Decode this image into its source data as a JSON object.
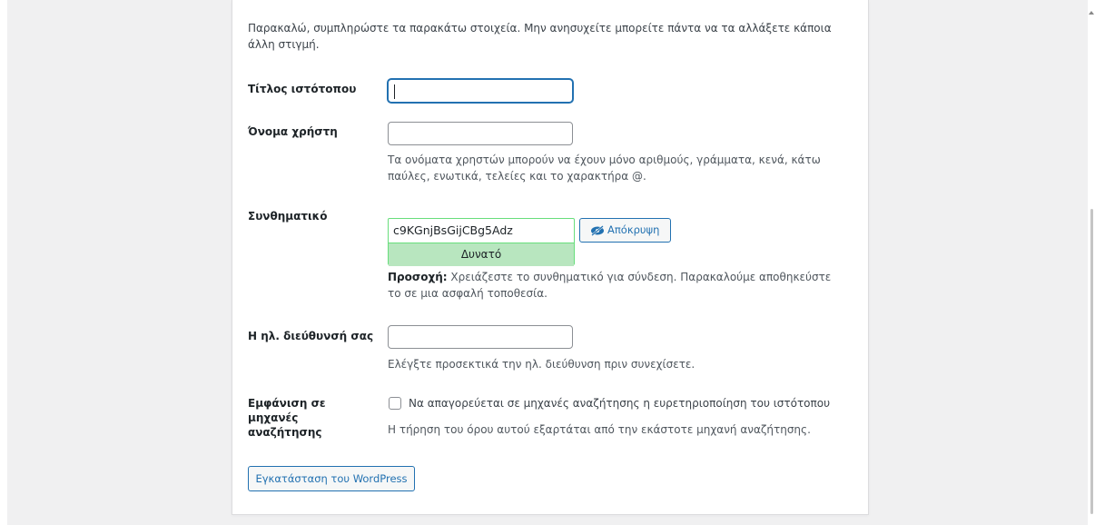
{
  "intro_text": "Παρακαλώ, συμπληρώστε τα παρακάτω στοιχεία. Μην ανησυχείτε μπορείτε πάντα να τα αλλάξετε κάποια άλλη στιγμή.",
  "site_title": {
    "label": "Τίτλος ιστότοπου",
    "value": ""
  },
  "username": {
    "label": "Όνομα χρήστη",
    "value": "",
    "description": "Τα ονόματα χρηστών μπορούν να έχουν μόνο αριθμούς, γράμματα, κενά, κάτω παύλες, ενωτικά, τελείες και το χαρακτήρα @."
  },
  "password": {
    "label": "Συνθηματικό",
    "value": "c9KGnjBsGijCBg5Adz",
    "strength": "Δυνατό",
    "hide_button": "Απόκρυψη",
    "icon": "eye-slash-icon",
    "note_strong": "Προσοχή:",
    "note_text": "Χρειάζεστε το συνθηματικό για σύνδεση. Παρακαλούμε αποθηκεύστε το σε μια ασφαλή τοποθεσία."
  },
  "email": {
    "label": "Η ηλ. διεύθυνσή σας",
    "value": "",
    "description": "Ελέγξτε προσεκτικά την ηλ. διεύθυνση πριν συνεχίσετε."
  },
  "search_engines": {
    "label": "Εμφάνιση σε μηχανές αναζήτησης",
    "checkbox_label": "Να απαγορεύεται σε μηχανές αναζήτησης η ευρετηριοποίηση του ιστότοπου",
    "checked": false,
    "description": "Η τήρηση του όρου αυτού εξαρτάται από την εκάστοτε μηχανή αναζήτησης."
  },
  "install_button": "Εγκατάσταση του WordPress",
  "colors": {
    "accent": "#2271b1",
    "strength_bg": "#b8e6bf",
    "strength_border": "#68de7c"
  }
}
